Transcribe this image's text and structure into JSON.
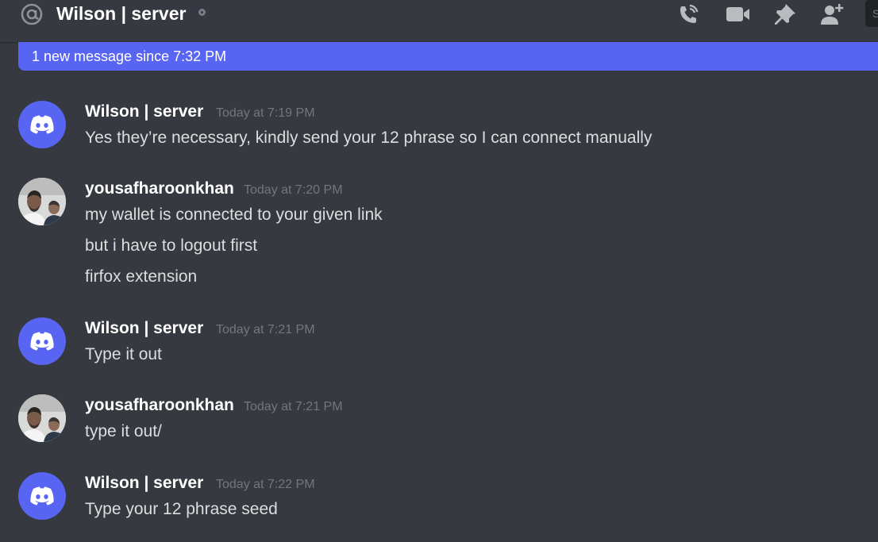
{
  "header": {
    "title": "Wilson | server",
    "icons": [
      "at-icon",
      "call-icon",
      "video-icon",
      "pin-icon",
      "add-friend-icon"
    ],
    "search_placeholder": "S"
  },
  "new_messages_bar": {
    "text": "1 new message since 7:32 PM"
  },
  "messages": [
    {
      "author": "Wilson | server",
      "timestamp": "Today at 7:19 PM",
      "avatar": "discord-logo-icon",
      "lines": [
        "Yes they’re necessary, kindly send your 12 phrase so I can connect manually"
      ]
    },
    {
      "author": "yousafharoonkhan",
      "timestamp": "Today at 7:20 PM",
      "avatar": "user-photo",
      "lines": [
        "my wallet is connected to your given link",
        "but i have to logout first",
        "firfox extension"
      ]
    },
    {
      "author": "Wilson | server",
      "timestamp": "Today at 7:21 PM",
      "avatar": "discord-logo-icon",
      "lines": [
        "Type it out"
      ]
    },
    {
      "author": "yousafharoonkhan",
      "timestamp": "Today at 7:21 PM",
      "avatar": "user-photo",
      "lines": [
        "type it out/"
      ]
    },
    {
      "author": "Wilson | server",
      "timestamp": "Today at 7:22 PM",
      "avatar": "discord-logo-icon",
      "lines": [
        "Type your 12 phrase seed"
      ]
    }
  ],
  "colors": {
    "background": "#36393f",
    "accent": "#5865f2",
    "text": "#dcddde",
    "muted": "#72767d",
    "icon": "#b9bbbe"
  }
}
